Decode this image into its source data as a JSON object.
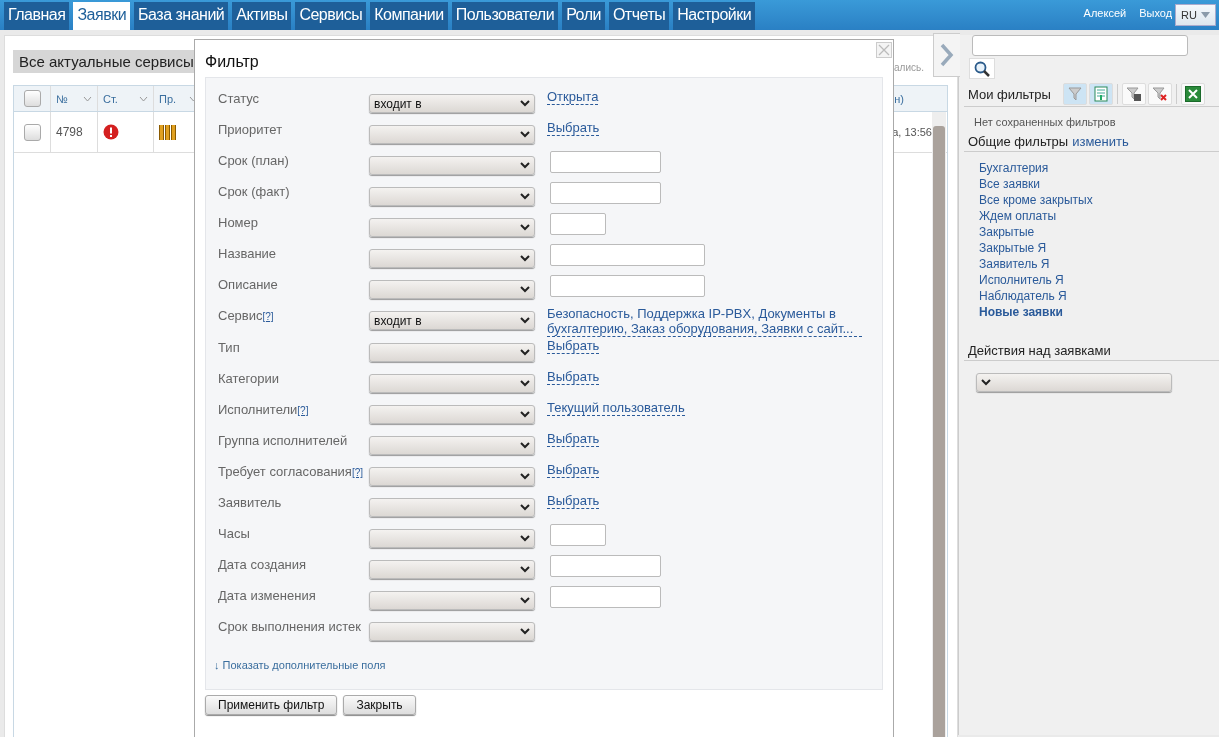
{
  "nav": {
    "tabs": [
      {
        "label": "Главная",
        "selected": false
      },
      {
        "label": "Заявки",
        "selected": true
      },
      {
        "label": "База знаний",
        "selected": false
      },
      {
        "label": "Активы",
        "selected": false
      },
      {
        "label": "Сервисы",
        "selected": false
      },
      {
        "label": "Компании",
        "selected": false
      },
      {
        "label": "Пользователи",
        "selected": false
      },
      {
        "label": "Роли",
        "selected": false
      },
      {
        "label": "Отчеты",
        "selected": false
      },
      {
        "label": "Настройки",
        "selected": false
      }
    ],
    "user": "Алексей",
    "logout": "Выход",
    "language": "RU"
  },
  "list": {
    "title": "Все актуальные сервисы",
    "note_fragment": "ались.",
    "select_all_checked": false,
    "columns": [
      "№",
      "Ст.",
      "Пр."
    ],
    "column_fragment": "н)",
    "rows": [
      {
        "checked": false,
        "number": "4798",
        "color": "#d42020",
        "level": 1,
        "date_fragment": "а, 13:56"
      }
    ]
  },
  "filter_dialog": {
    "title": "Фильтр",
    "fields": [
      {
        "label": "Статус",
        "kind": "link",
        "operator": "входит в",
        "value": "Открыта"
      },
      {
        "label": "Приоритет",
        "kind": "link",
        "value": "Выбрать"
      },
      {
        "label": "Срок (план)",
        "kind": "date"
      },
      {
        "label": "Срок (факт)",
        "kind": "date"
      },
      {
        "label": "Номер",
        "kind": "number"
      },
      {
        "label": "Название",
        "kind": "text"
      },
      {
        "label": "Описание",
        "kind": "text"
      },
      {
        "label": "Сервис",
        "help": "[?]",
        "kind": "link",
        "operator": "входит в",
        "value": "Безопасность, Поддержка IP-PBX, Документы в бухгалтерию, Заказ оборудования, Заявки с сайт..."
      },
      {
        "label": "Тип",
        "kind": "link",
        "value": "Выбрать"
      },
      {
        "label": "Категории",
        "kind": "link",
        "value": "Выбрать"
      },
      {
        "label": "Исполнители",
        "help": "[?]",
        "kind": "link",
        "value": "Текущий пользователь"
      },
      {
        "label": "Группа исполнителей",
        "kind": "link",
        "value": "Выбрать"
      },
      {
        "label": "Требует согласования",
        "help": "[?]",
        "kind": "link",
        "value": "Выбрать"
      },
      {
        "label": "Заявитель",
        "kind": "link",
        "value": "Выбрать"
      },
      {
        "label": "Часы",
        "kind": "number"
      },
      {
        "label": "Дата создания",
        "kind": "date"
      },
      {
        "label": "Дата изменения",
        "kind": "date"
      },
      {
        "label": "Срок выполнения истек",
        "kind": "none"
      }
    ],
    "more_link": "↓ Показать дополнительные поля",
    "buttons": [
      "Применить фильтр",
      "Закрыть"
    ]
  },
  "sidebar": {
    "my_filters": "Мои фильтры",
    "no_filters": "Нет сохраненных фильтров",
    "common_filters": "Общие фильтры",
    "edit_link": "изменить",
    "filters": [
      {
        "label": "Бухгалтерия",
        "selected": false
      },
      {
        "label": "Все заявки",
        "selected": false
      },
      {
        "label": "Все кроме закрытых",
        "selected": false
      },
      {
        "label": "Ждем оплаты",
        "selected": false
      },
      {
        "label": "Закрытые",
        "selected": false
      },
      {
        "label": "Закрытые Я",
        "selected": false
      },
      {
        "label": "Заявитель Я",
        "selected": false
      },
      {
        "label": "Исполнитель Я",
        "selected": false
      },
      {
        "label": "Наблюдатель Я",
        "selected": false
      },
      {
        "label": "Новые заявки",
        "selected": true
      }
    ],
    "actions_title": "Действия над заявками"
  }
}
